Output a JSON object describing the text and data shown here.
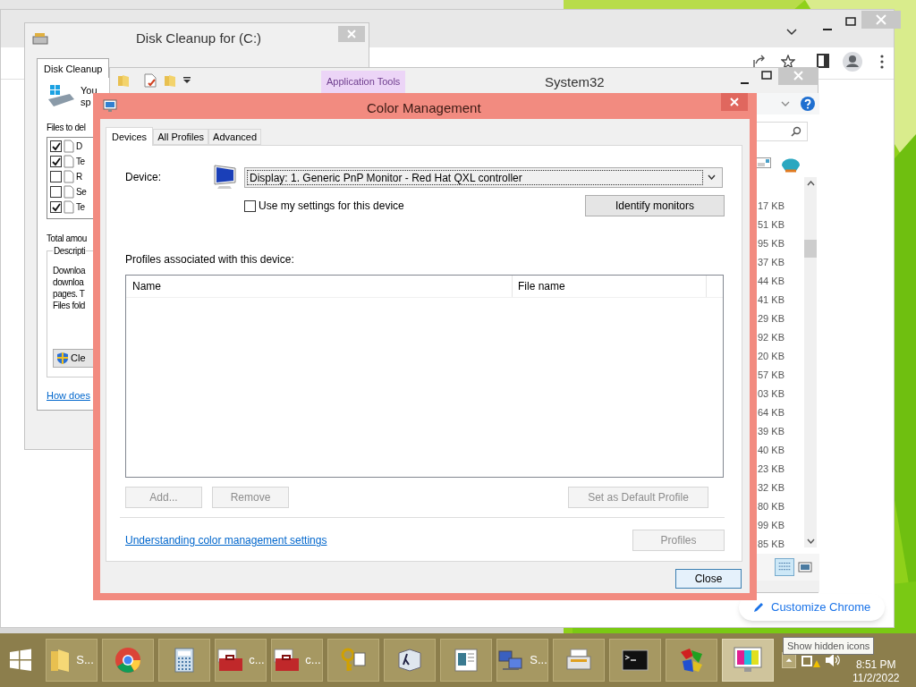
{
  "chrome": {
    "customize_button": "Customize Chrome"
  },
  "disk_cleanup": {
    "title": "Disk Cleanup for  (C:)",
    "tab": "Disk Cleanup",
    "intro": [
      "You",
      "sp"
    ],
    "files_label": "Files to del",
    "files": [
      {
        "label": "D",
        "checked": true
      },
      {
        "label": "Te",
        "checked": true
      },
      {
        "label": "R",
        "checked": false
      },
      {
        "label": "Se",
        "checked": false
      },
      {
        "label": "Te",
        "checked": true
      }
    ],
    "total_label": "Total amou",
    "description_title": "Descripti",
    "description_lines": [
      "Downloa",
      "downloa",
      "pages. T",
      "Files fold"
    ],
    "clean_button": "Cle",
    "help_link": "How does"
  },
  "explorer": {
    "ribbon_tab": "Application Tools",
    "title": "System32",
    "sizes": [
      "17 KB",
      "51 KB",
      "95 KB",
      "37 KB",
      "44 KB",
      "41 KB",
      "29 KB",
      "92 KB",
      "20 KB",
      "57 KB",
      "03 KB",
      "64 KB",
      "39 KB",
      "40 KB",
      "23 KB",
      "32 KB",
      "80 KB",
      "99 KB",
      "85 KB"
    ]
  },
  "color_management": {
    "title": "Color Management",
    "tabs": [
      {
        "label": "Devices",
        "selected": true
      },
      {
        "label": "All Profiles",
        "selected": false
      },
      {
        "label": "Advanced",
        "selected": false
      }
    ],
    "device_label": "Device:",
    "device_value": "Display: 1. Generic PnP Monitor - Red Hat QXL controller",
    "use_settings": {
      "label": "Use my settings for this device",
      "checked": false
    },
    "identify_button": "Identify monitors",
    "profiles_label": "Profiles associated with this device:",
    "columns": [
      "Name",
      "File name"
    ],
    "list_buttons": [
      {
        "label": "Add...",
        "disabled": true
      },
      {
        "label": "Remove",
        "disabled": true
      },
      {
        "label": "Set as Default Profile",
        "disabled": true
      }
    ],
    "link": "Understanding color management settings",
    "profiles_button": {
      "label": "Profiles",
      "disabled": true
    },
    "close_button": "Close"
  },
  "taskbar": {
    "items": [
      {
        "kind": "folder",
        "label": "S...",
        "selected": false
      },
      {
        "kind": "chrome",
        "selected": false
      },
      {
        "kind": "calculator",
        "selected": false
      },
      {
        "kind": "toolbox",
        "label": "c...",
        "selected": false
      },
      {
        "kind": "toolbox",
        "label": "c...",
        "selected": false
      },
      {
        "kind": "keys",
        "selected": false
      },
      {
        "kind": "lambda",
        "selected": false
      },
      {
        "kind": "document",
        "selected": false
      },
      {
        "kind": "network",
        "label": "S...",
        "selected": false
      },
      {
        "kind": "printer",
        "selected": false
      },
      {
        "kind": "console",
        "selected": false
      },
      {
        "kind": "puzzle",
        "selected": false
      },
      {
        "kind": "monitor",
        "selected": true
      }
    ],
    "time": "8:51 PM",
    "date": "11/2/2022",
    "tooltip": "Show hidden icons"
  }
}
